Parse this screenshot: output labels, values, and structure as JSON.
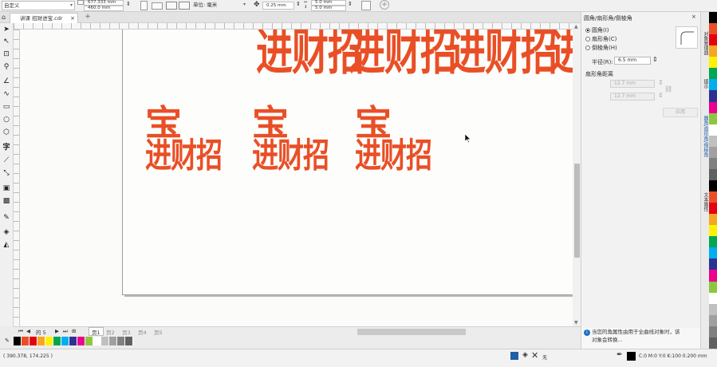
{
  "property_bar": {
    "preset": "自定义",
    "width_value": "677.333 mm",
    "height_value": "460.0 mm",
    "units_label": "单位: 毫米",
    "nudge_value": "0.25 mm",
    "dup_x": "5.0 mm",
    "dup_y": "5.0 mm"
  },
  "tabs": {
    "document": "讲课 招财进宝.cdr"
  },
  "canvas": {
    "row1_char": "进财招",
    "row1_last_char": "进",
    "row2_char_top": "宝",
    "row2_char_bottom": "进财招"
  },
  "page_nav": {
    "page_of": "的 5",
    "pages": [
      "页1",
      "页2",
      "页3",
      "页4",
      "页5"
    ]
  },
  "status": {
    "coords": "( 390.378, 174.225 )",
    "fill_none": "无",
    "color_readout": "C:0 M:0 Y:0 K:100  0.200 mm"
  },
  "docker": {
    "title": "圆角/扇形角/倒棱角",
    "option_round": "圆角(I)",
    "option_scallop": "扇形角(C)",
    "option_chamfer": "倒棱角(H)",
    "radius_label": "半径(R):",
    "radius_value": "6.5 mm",
    "distance_label": "扇形角距离",
    "distance_a": "12.7 mm",
    "distance_b": "12.7 mm",
    "apply_label": "应用",
    "info_line1": "当您的角属性由用于全曲线对象时，该",
    "info_line2": "对象会转换..."
  },
  "vertical_tabs": [
    "对象管理器",
    "提示",
    "圆角/扇形角/倒棱角",
    "文本属性"
  ],
  "colors": {
    "accent": "#e94f26",
    "palette": [
      "#000000",
      "#e94f26",
      "#e60012",
      "#f5a623",
      "#fff200",
      "#00a651",
      "#00aeef",
      "#2e3192",
      "#ec008c",
      "#8dc63f",
      "#ffffff",
      "#c0c0c0",
      "#a0a0a0",
      "#808080",
      "#606060"
    ]
  }
}
